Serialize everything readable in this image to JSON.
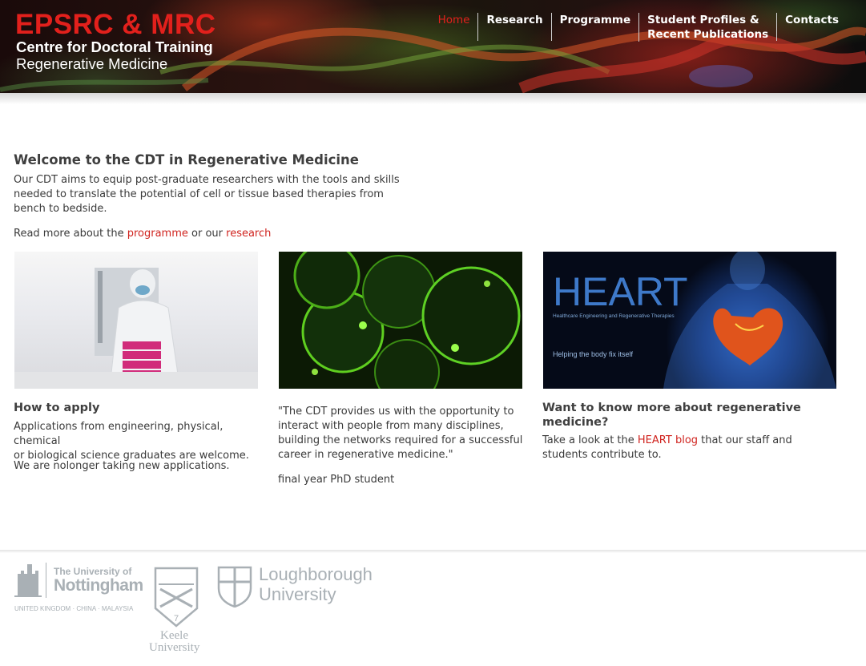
{
  "header": {
    "logo": {
      "line1": "EPSRC & MRC",
      "line2": "Centre for Doctoral Training",
      "line3": "Regenerative Medicine"
    },
    "nav": [
      {
        "label": "Home",
        "active": true
      },
      {
        "label": "Research",
        "active": false
      },
      {
        "label": "Programme",
        "active": false
      },
      {
        "label": "Student Profiles &",
        "label2": "Recent Publications",
        "active": false
      },
      {
        "label": "Contacts",
        "active": false
      }
    ]
  },
  "welcome": {
    "title": "Welcome to the CDT in Regenerative Medicine",
    "line1": "Our CDT aims to equip post-graduate researchers with the tools and skills",
    "line2": "needed to translate the potential of cell or tissue based therapies  from",
    "line3": "bench to bedside.",
    "readmore_prefix": "Read more about the",
    "readmore_link1": "programme",
    "readmore_mid": "or our",
    "readmore_link2": "research"
  },
  "columns": {
    "apply": {
      "title": "How to apply",
      "text_line1": "Applications from engineering, physical, chemical",
      "text_line2": "or biological science graduates are welcome.",
      "text2": "We are nolonger taking new applications."
    },
    "quote": {
      "line1": "\"The CDT provides us with the opportunity to",
      "line2": "interact with people from many disciplines,",
      "line3": "building the networks required for a successful",
      "line4": "career in regenerative medicine.\"",
      "attribution": "final year PhD student"
    },
    "heart": {
      "title_line1": "Want to know more about regenerative",
      "title_line2": "medicine?",
      "text_prefix": "Take a look at the",
      "link": "HEART blog",
      "text_suffix": "that our staff and",
      "text_line2": "students contribute to.",
      "image_title": "HEART",
      "image_subtitle": "Healthcare Engineering and Regenerative Therapies",
      "image_tagline": "Helping the body fix itself"
    }
  },
  "footer": {
    "nottingham": {
      "line1": "The University of",
      "line2": "Nottingham",
      "line3": "UNITED KINGDOM · CHINA · MALAYSIA"
    },
    "keele": {
      "line1": "Keele",
      "line2": "University",
      "shield_number": "7"
    },
    "loughborough": {
      "line1": "Loughborough",
      "line2": "University"
    }
  },
  "colors": {
    "accent_red": "#e2201c",
    "link_red": "#d0241f",
    "text": "#3a3a3a",
    "logo_gray": "#a9b0b5"
  }
}
